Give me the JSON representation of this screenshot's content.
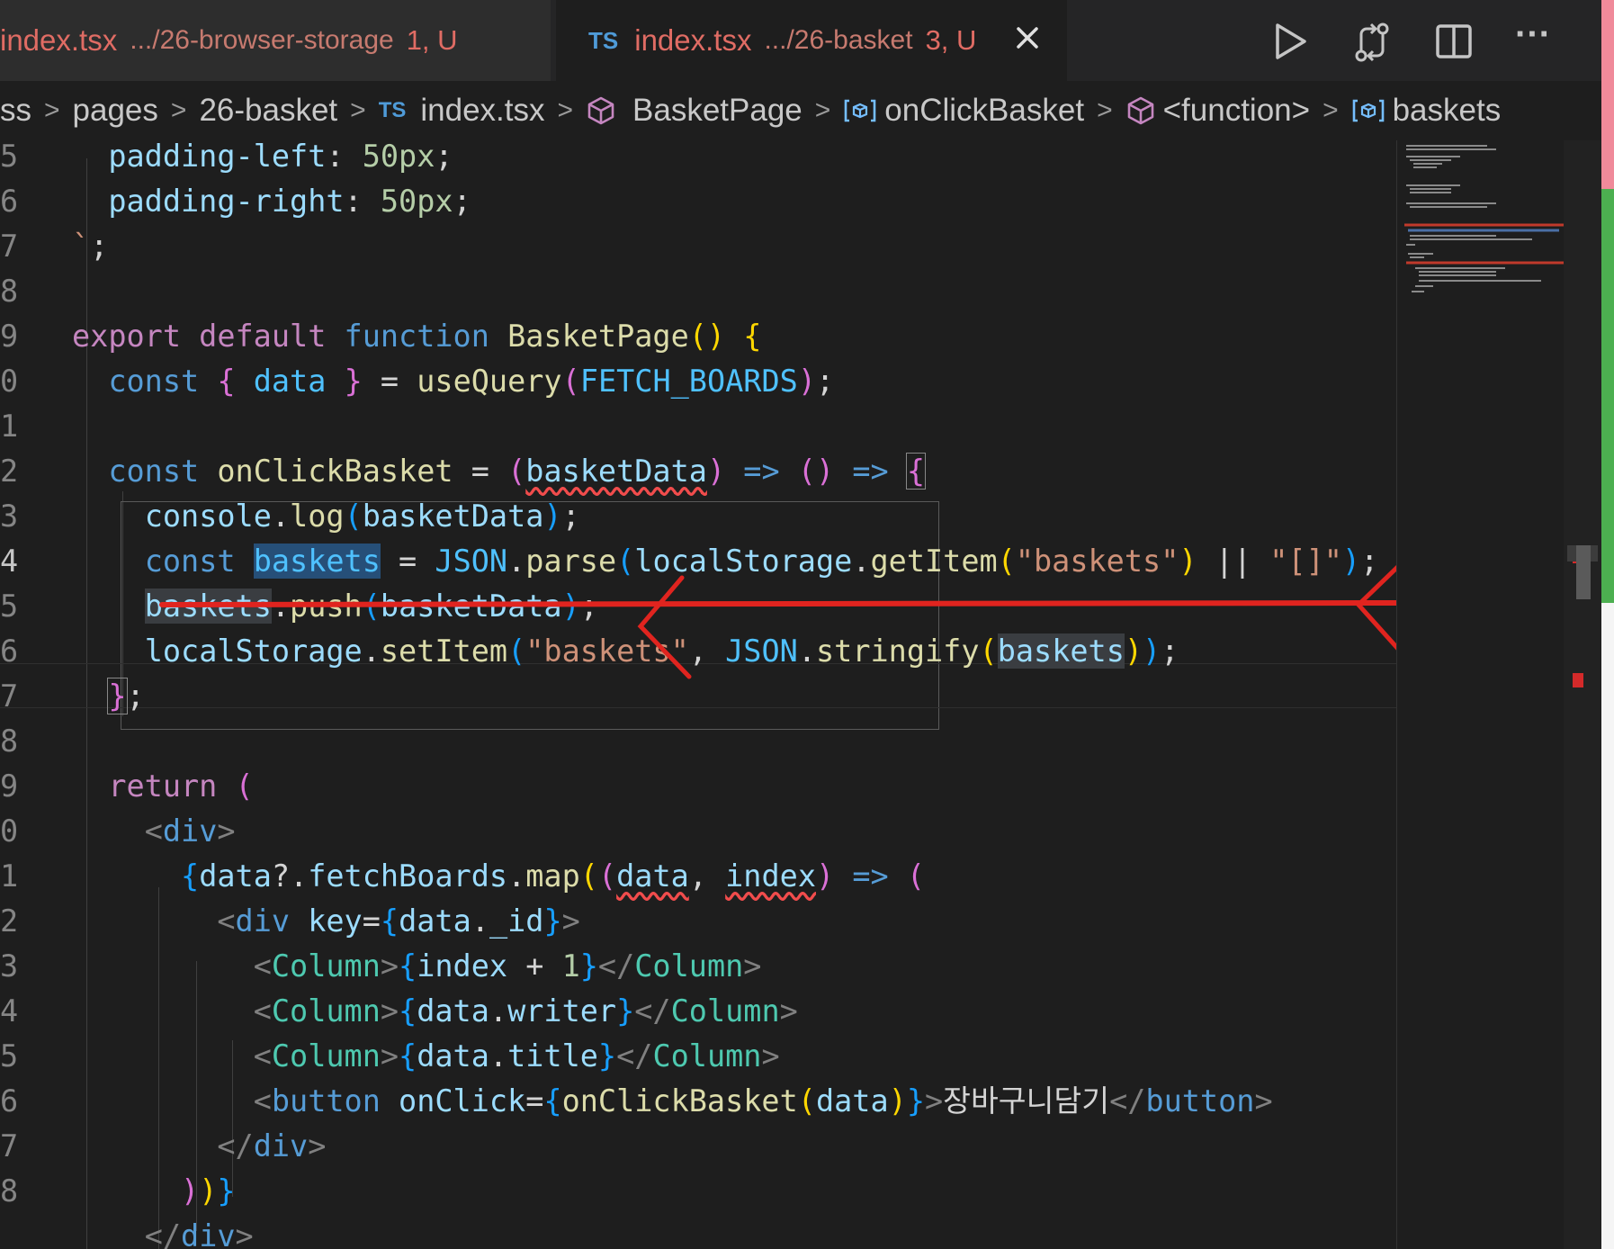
{
  "tabs": [
    {
      "icon": "TS",
      "file": "index.tsx",
      "path": ".../26-browser-storage",
      "badge": "1, U",
      "active": false
    },
    {
      "icon": "TS",
      "file": "index.tsx",
      "path": ".../26-basket",
      "badge": "3, U",
      "active": true
    }
  ],
  "toolbar_icons": [
    "run-icon",
    "compare-changes-icon",
    "split-editor-icon",
    "more-actions-icon"
  ],
  "more_label": "···",
  "breadcrumb": [
    {
      "label": "ss",
      "icon": ""
    },
    {
      "label": "pages",
      "icon": ""
    },
    {
      "label": "26-basket",
      "icon": ""
    },
    {
      "label": "index.tsx",
      "icon": "TS"
    },
    {
      "label": "BasketPage",
      "icon": "cube-icon"
    },
    {
      "label": "onClickBasket",
      "icon": "variable-icon"
    },
    {
      "label": "<function>",
      "icon": "cube-icon"
    },
    {
      "label": "baskets",
      "icon": "variable-icon"
    }
  ],
  "line_numbers": [
    "5",
    "6",
    "7",
    "8",
    "9",
    "0",
    "1",
    "2",
    "3",
    "4",
    "5",
    "6",
    "7",
    "8",
    "9",
    "0",
    "1",
    "2",
    "3",
    "4",
    "5",
    "6",
    "7",
    "8"
  ],
  "active_line_index": 9,
  "korean_button_text": "장바구니담기",
  "annotation_color": "#e0241f",
  "colors": {
    "editor_bg": "#1e1e1e",
    "tab_modified": "#e06c64",
    "selection": "#264f78"
  }
}
